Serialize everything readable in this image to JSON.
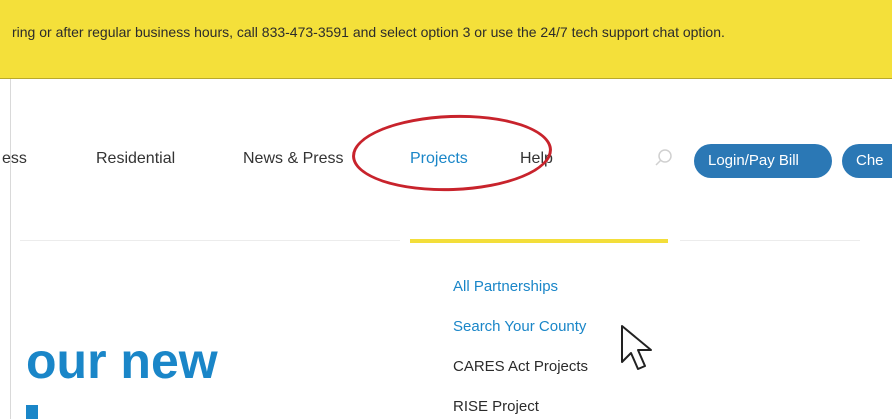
{
  "banner": {
    "text": "ring or after regular business hours, call 833-473-3591 and select option 3 or use the 24/7 tech support chat option."
  },
  "nav": {
    "items": [
      "ess",
      "Residential",
      "News & Press",
      "Projects",
      "Help"
    ],
    "login_label": "Login/Pay Bill",
    "check_label": "Che"
  },
  "dropdown": {
    "items": [
      "All Partnerships",
      "Search Your County",
      "CARES Act Projects",
      "RISE Project"
    ]
  },
  "hero": {
    "text": "our new"
  },
  "icons": {
    "search": "search-icon",
    "cursor": "mouse-pointer-icon"
  },
  "colors": {
    "banner": "#f4e03a",
    "link_blue": "#1a86c8",
    "button_blue": "#2b78b5",
    "annotation_red": "#c8232c",
    "accent_yellow": "#f3de3a"
  }
}
